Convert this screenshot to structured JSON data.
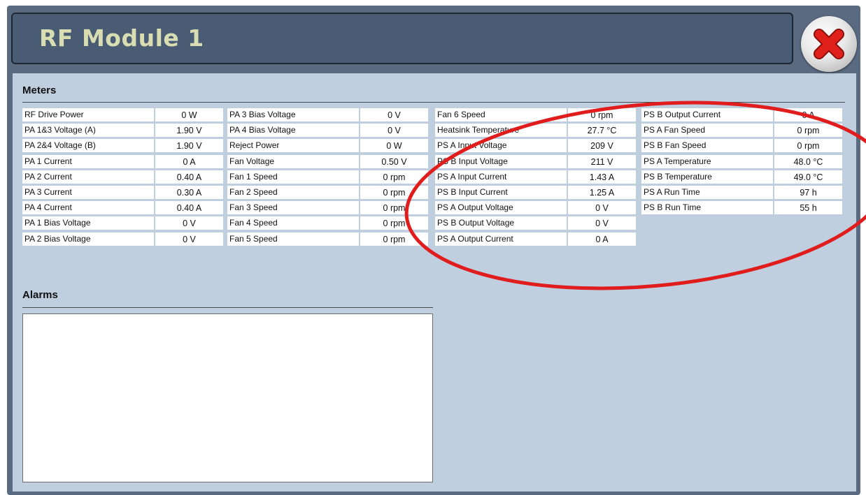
{
  "window": {
    "title": "RF Module 1"
  },
  "close_icon": "close-icon",
  "colors": {
    "title_bar": "#4a5b74",
    "title_text": "#d8ddb2",
    "panel_bg": "#bfcfe0",
    "annotation_circle": "#e11c1c",
    "close_x": "#e0211b"
  },
  "meters": {
    "title": "Meters",
    "columns": [
      [
        {
          "label": "RF Drive Power",
          "value": "0 W"
        },
        {
          "label": "PA 1&3 Voltage (A)",
          "value": "1.90 V"
        },
        {
          "label": "PA 2&4 Voltage (B)",
          "value": "1.90 V"
        },
        {
          "label": "PA 1 Current",
          "value": "0 A"
        },
        {
          "label": "PA 2 Current",
          "value": "0.40 A"
        },
        {
          "label": "PA 3 Current",
          "value": "0.30 A"
        },
        {
          "label": "PA 4 Current",
          "value": "0.40 A"
        },
        {
          "label": "PA 1 Bias Voltage",
          "value": "0 V"
        },
        {
          "label": "PA 2 Bias Voltage",
          "value": "0 V"
        }
      ],
      [
        {
          "label": "PA 3 Bias Voltage",
          "value": "0 V"
        },
        {
          "label": "PA 4 Bias Voltage",
          "value": "0 V"
        },
        {
          "label": "Reject Power",
          "value": "0 W"
        },
        {
          "label": "Fan Voltage",
          "value": "0.50 V"
        },
        {
          "label": "Fan 1 Speed",
          "value": "0 rpm"
        },
        {
          "label": "Fan 2 Speed",
          "value": "0 rpm"
        },
        {
          "label": "Fan 3 Speed",
          "value": "0 rpm"
        },
        {
          "label": "Fan 4 Speed",
          "value": "0 rpm"
        },
        {
          "label": "Fan 5 Speed",
          "value": "0 rpm"
        }
      ],
      [
        {
          "label": "Fan 6 Speed",
          "value": "0 rpm"
        },
        {
          "label": "Heatsink Temperature",
          "value": "27.7 °C"
        },
        {
          "label": "PS A Input Voltage",
          "value": "209 V"
        },
        {
          "label": "PS B Input Voltage",
          "value": "211 V"
        },
        {
          "label": "PS A Input Current",
          "value": "1.43 A"
        },
        {
          "label": "PS B Input Current",
          "value": "1.25 A"
        },
        {
          "label": "PS A Output Voltage",
          "value": "0 V"
        },
        {
          "label": "PS B Output Voltage",
          "value": "0 V"
        },
        {
          "label": "PS A Output Current",
          "value": "0 A"
        }
      ],
      [
        {
          "label": "PS B Output Current",
          "value": "0 A"
        },
        {
          "label": "PS A Fan Speed",
          "value": "0 rpm"
        },
        {
          "label": "PS B Fan Speed",
          "value": "0 rpm"
        },
        {
          "label": "PS A Temperature",
          "value": "48.0 °C"
        },
        {
          "label": "PS B Temperature",
          "value": "49.0 °C"
        },
        {
          "label": "PS A Run Time",
          "value": "97 h"
        },
        {
          "label": "PS B Run Time",
          "value": "55 h"
        }
      ]
    ]
  },
  "alarms": {
    "title": "Alarms",
    "items": []
  }
}
